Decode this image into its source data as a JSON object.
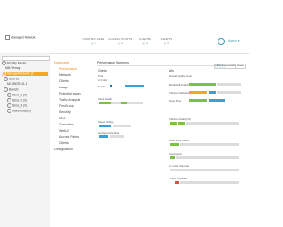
{
  "header": {
    "title": "Managed Network",
    "stats": [
      {
        "label": "CONTROLLERS",
        "value": "1"
      },
      {
        "label": "ACCESS POINTS",
        "value": "1"
      },
      {
        "label": "CLIENTS",
        "value": "1"
      },
      {
        "label": "ALERTS",
        "value": "1"
      }
    ],
    "user_label": "Admin"
  },
  "tree": [
    {
      "label": "Managed Network"
    },
    {
      "label": "Mobility Master"
    },
    {
      "label": "MM-Primary"
    },
    {
      "label": "Managed Network (1)"
    },
    {
      "label": "Cust-01"
    },
    {
      "label": "MC-WEST-01-1"
    },
    {
      "label": "Branch1"
    },
    {
      "label": "Store_1 (0)"
    },
    {
      "label": "Store_2 (0)"
    },
    {
      "label": "Store_3 (0)"
    },
    {
      "label": "Warehouse (0)"
    }
  ],
  "menu": {
    "items": [
      "Dashboard",
      "Performance",
      "Network",
      "Clients",
      "Usage",
      "Potential Issues",
      "Traffic Analysis",
      "FirstGroup",
      "Security",
      "UCC",
      "Controllers",
      "WebUI",
      "Access Points",
      "Clients",
      "Configuration"
    ],
    "active_index": 1
  },
  "main": {
    "title": "Performance Summary",
    "clients_header": "Clients",
    "aps_header": "APs",
    "tab_all": "All Radios",
    "tab_24": "2.4 GHz",
    "tab_5": "5 GHz",
    "client_rows": [
      {
        "label": "Total",
        "value": "1"
      },
      {
        "label": "2.4 GHz",
        "value": "0"
      },
      {
        "label": "5 GHz",
        "value": "1"
      }
    ],
    "client_health_label": "Client Health",
    "speed_label": "Speed (Gbps)",
    "goodput_label": "Goodput Data Rate",
    "ap_rows": [
      "Overall Quality Level",
      "Bandwidth Availability",
      "Channel Utilization",
      "Noise Floor",
      "Channel Quality (%)",
      "Noise Floor (dBm)",
      "Interference",
      "2.4 GHz Channels",
      "5 GHz Channels"
    ]
  }
}
